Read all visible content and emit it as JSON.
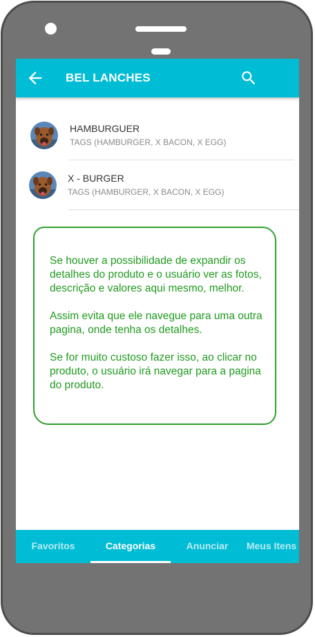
{
  "appbar": {
    "title": "BEL LANCHES",
    "back_icon": "arrow-back-icon",
    "search_icon": "search-icon"
  },
  "products": [
    {
      "name": "HAMBURGUER",
      "tags": "TAGS (HAMBURGER, X BACON, X EGG)",
      "avatar_icon": "dog-avatar-icon"
    },
    {
      "name": "X - BURGER",
      "tags": "TAGS (HAMBURGER, X BACON, X EGG)",
      "avatar_icon": "dog-avatar-icon"
    }
  ],
  "annotation": {
    "text": "Se houver a possibilidade de expandir os detalhes do produto e o usuário ver as fotos, descrição e valores aqui mesmo, melhor.\n\nAssim evita que ele navegue para uma outra pagina,  onde tenha os detalhes.\n\nSe for muito custoso fazer isso,  ao clicar no produto, o usuário irá navegar para a pagina do produto."
  },
  "tabs": [
    {
      "label": "Favoritos",
      "active": false
    },
    {
      "label": "Categorias",
      "active": true
    },
    {
      "label": "Anunciar",
      "active": false
    },
    {
      "label": "Meus Itens",
      "active": false
    }
  ],
  "colors": {
    "primary": "#00bcd4",
    "annotation_green": "#1f9a1f",
    "phone_body": "#737373"
  }
}
